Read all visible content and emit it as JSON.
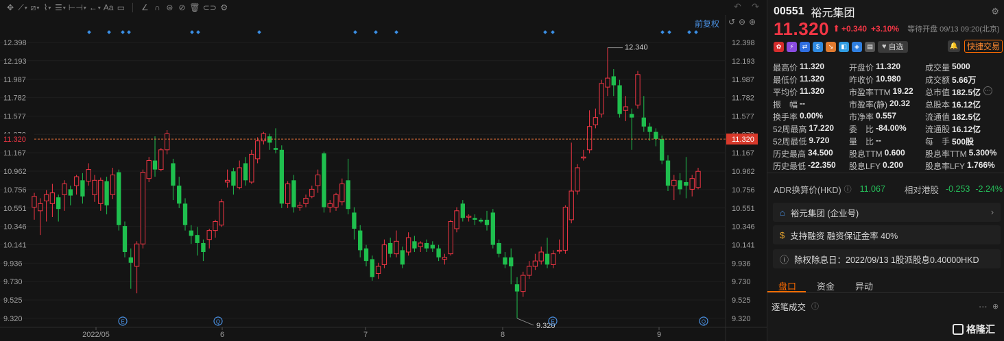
{
  "toolbar": {
    "icons": [
      "crosshair-icon",
      "line-tool-icon",
      "channel-tool-icon",
      "wave-tool-icon",
      "fib-tool-icon",
      "measure-tool-icon",
      "arrow-tool-icon",
      "text-tool-icon",
      "comment-tool-icon",
      "ruler-icon",
      "magnet-icon",
      "lock-draw-icon",
      "hide-draw-icon",
      "delete-icon",
      "toggle-icon",
      "settings-icon"
    ],
    "text_label": "Aa"
  },
  "chart": {
    "adjust_label": "前复权",
    "current_price_label": "11.320",
    "high_marker": "12.340",
    "low_marker": "9.320",
    "event_e": "E",
    "event_q": "Q"
  },
  "chart_data": {
    "type": "candlestick",
    "ylim": [
      9.22,
      12.52
    ],
    "yticks": [
      "12.398",
      "12.193",
      "11.987",
      "11.782",
      "11.577",
      "11.372",
      "11.167",
      "10.962",
      "10.756",
      "10.551",
      "10.346",
      "10.141",
      "9.936",
      "9.730",
      "9.525",
      "9.320"
    ],
    "xticks": [
      "2022/05",
      "6",
      "7",
      "8",
      "9"
    ],
    "current_price": 11.32,
    "candles": [
      [
        10.56,
        10.68,
        10.42,
        10.72
      ],
      [
        10.52,
        10.6,
        10.25,
        10.66
      ],
      [
        10.63,
        10.7,
        10.4,
        10.75
      ],
      [
        10.6,
        10.72,
        10.45,
        10.82
      ],
      [
        10.67,
        10.54,
        10.4,
        10.7
      ],
      [
        10.7,
        10.82,
        10.52,
        10.86
      ],
      [
        10.76,
        10.69,
        10.58,
        10.8
      ],
      [
        10.8,
        10.9,
        10.7,
        10.92
      ],
      [
        10.86,
        10.68,
        10.6,
        10.94
      ],
      [
        10.85,
        10.98,
        10.8,
        11.05
      ],
      [
        10.7,
        10.86,
        10.62,
        10.92
      ],
      [
        10.6,
        10.86,
        10.52,
        10.89
      ],
      [
        10.85,
        10.58,
        10.48,
        10.9
      ],
      [
        10.7,
        10.92,
        10.65,
        11.0
      ],
      [
        10.95,
        10.36,
        10.3,
        10.98
      ],
      [
        10.35,
        10.06,
        10.0,
        10.4
      ],
      [
        10.0,
        9.94,
        9.65,
        10.1
      ],
      [
        9.9,
        10.15,
        9.6,
        10.18
      ],
      [
        10.15,
        10.95,
        10.1,
        10.98
      ],
      [
        10.88,
        11.08,
        10.84,
        11.12
      ],
      [
        11.08,
        10.98,
        10.9,
        11.35
      ],
      [
        10.98,
        11.2,
        10.96,
        11.22
      ],
      [
        11.2,
        11.38,
        11.15,
        11.42
      ],
      [
        11.05,
        10.8,
        10.64,
        11.1
      ],
      [
        10.8,
        10.6,
        10.55,
        10.9
      ],
      [
        10.6,
        10.36,
        10.3,
        10.66
      ],
      [
        10.3,
        10.24,
        10.15,
        10.36
      ],
      [
        10.25,
        10.16,
        10.02,
        10.34
      ],
      [
        10.16,
        10.06,
        9.96,
        10.2
      ],
      [
        10.2,
        10.3,
        10.1,
        10.32
      ],
      [
        10.3,
        10.4,
        10.22,
        10.42
      ],
      [
        10.36,
        10.62,
        10.34,
        10.65
      ],
      [
        10.84,
        10.86,
        10.78,
        10.98
      ],
      [
        10.96,
        10.8,
        10.7,
        11.0
      ],
      [
        10.78,
        11.0,
        10.76,
        11.08
      ],
      [
        11.05,
        10.86,
        10.8,
        11.12
      ],
      [
        10.84,
        11.15,
        10.82,
        11.2
      ],
      [
        11.1,
        11.3,
        11.05,
        11.34
      ],
      [
        11.3,
        11.38,
        11.26,
        11.4
      ],
      [
        11.35,
        11.28,
        11.2,
        11.38
      ],
      [
        11.22,
        11.2,
        11.16,
        11.44
      ],
      [
        11.2,
        10.6,
        10.55,
        11.25
      ],
      [
        10.6,
        10.82,
        10.55,
        10.85
      ],
      [
        10.86,
        10.56,
        10.5,
        10.92
      ],
      [
        10.56,
        10.58,
        10.52,
        10.62
      ],
      [
        10.6,
        10.66,
        10.56,
        10.7
      ],
      [
        10.68,
        10.76,
        10.66,
        10.8
      ],
      [
        10.8,
        10.92,
        10.72,
        10.98
      ],
      [
        11.16,
        10.56,
        10.5,
        11.18
      ],
      [
        10.56,
        10.6,
        10.5,
        10.64
      ],
      [
        10.56,
        10.7,
        10.52,
        10.72
      ],
      [
        10.62,
        10.82,
        10.58,
        10.88
      ],
      [
        10.86,
        10.54,
        10.48,
        11.1
      ],
      [
        10.5,
        10.32,
        10.2,
        10.56
      ],
      [
        10.3,
        10.08,
        10.0,
        10.36
      ],
      [
        10.1,
        9.96,
        9.9,
        10.14
      ],
      [
        9.98,
        9.78,
        9.74,
        10.02
      ],
      [
        9.82,
        9.9,
        9.76,
        9.94
      ],
      [
        9.92,
        10.14,
        9.88,
        10.2
      ],
      [
        10.16,
        10.04,
        10.0,
        10.22
      ],
      [
        10.04,
        10.18,
        10.0,
        10.3
      ],
      [
        10.08,
        9.92,
        9.88,
        10.12
      ],
      [
        10.06,
        10.22,
        10.02,
        10.28
      ],
      [
        10.18,
        10.1,
        10.06,
        10.24
      ],
      [
        10.12,
        10.16,
        10.06,
        10.18
      ],
      [
        10.16,
        10.1,
        10.06,
        10.2
      ],
      [
        10.14,
        10.1,
        10.06,
        10.18
      ],
      [
        10.1,
        10.0,
        9.96,
        10.14
      ],
      [
        9.98,
        10.0,
        9.92,
        10.04
      ],
      [
        10.04,
        10.4,
        10.02,
        10.42
      ],
      [
        10.32,
        10.52,
        10.28,
        10.56
      ],
      [
        10.6,
        10.44,
        10.4,
        10.64
      ],
      [
        10.46,
        10.46,
        10.4,
        10.48
      ],
      [
        10.44,
        10.42,
        10.36,
        10.48
      ],
      [
        10.42,
        10.4,
        10.38,
        10.44
      ],
      [
        10.42,
        10.36,
        10.3,
        10.52
      ],
      [
        10.5,
        10.14,
        10.1,
        10.54
      ],
      [
        10.16,
        10.04,
        10.0,
        10.2
      ],
      [
        10.0,
        9.92,
        9.88,
        10.06
      ],
      [
        10.0,
        9.9,
        9.7,
        10.1
      ],
      [
        9.7,
        9.62,
        9.32,
        9.78
      ],
      [
        9.62,
        9.8,
        9.56,
        9.84
      ],
      [
        9.8,
        9.9,
        9.76,
        9.96
      ],
      [
        9.9,
        9.96,
        9.86,
        10.04
      ],
      [
        9.96,
        10.06,
        9.92,
        10.12
      ],
      [
        10.04,
        9.92,
        9.88,
        10.22
      ],
      [
        9.92,
        10.04,
        9.88,
        10.08
      ],
      [
        10.08,
        10.08,
        10.04,
        10.2
      ],
      [
        10.08,
        10.56,
        10.04,
        10.58
      ],
      [
        10.42,
        10.74,
        10.38,
        11.28
      ],
      [
        10.74,
        11.0,
        10.7,
        11.04
      ],
      [
        11.12,
        11.12,
        11.08,
        11.2
      ],
      [
        11.2,
        11.46,
        11.16,
        11.64
      ],
      [
        11.48,
        11.56,
        11.44,
        11.66
      ],
      [
        11.6,
        11.94,
        11.56,
        11.98
      ],
      [
        11.9,
        12.0,
        11.8,
        12.34
      ],
      [
        12.02,
        11.92,
        11.8,
        12.1
      ],
      [
        11.92,
        11.6,
        11.56,
        11.98
      ],
      [
        11.64,
        11.68,
        11.52,
        11.8
      ],
      [
        11.6,
        11.56,
        11.2,
        11.66
      ],
      [
        11.7,
        12.04,
        11.66,
        12.08
      ],
      [
        11.56,
        11.46,
        11.4,
        11.8
      ],
      [
        11.46,
        11.4,
        11.3,
        11.5
      ],
      [
        11.4,
        11.32,
        11.24,
        11.44
      ],
      [
        11.32,
        11.08,
        11.04,
        11.36
      ],
      [
        11.08,
        10.8,
        10.74,
        11.14
      ],
      [
        10.8,
        10.86,
        10.64,
        10.92
      ],
      [
        10.86,
        10.76,
        10.7,
        10.94
      ],
      [
        10.84,
        10.8,
        10.66,
        11.12
      ],
      [
        10.76,
        10.88,
        10.68,
        10.92
      ],
      [
        10.78,
        10.96,
        10.76,
        11.0
      ]
    ]
  },
  "quote": {
    "code": "00551",
    "name": "裕元集团",
    "price": "11.320",
    "arrow": "⬆",
    "change": "+0.340",
    "change_pct": "+3.10%",
    "status": "等待开盘 09/13 09:20(北京)",
    "watch_label": "自选",
    "quick_trade_label": "快捷交易"
  },
  "stats": [
    [
      {
        "k": "最高价",
        "v": "11.320",
        "c": "red"
      },
      {
        "k": "开盘价",
        "v": "11.320",
        "c": "red"
      },
      {
        "k": "成交量",
        "v": "5000",
        "c": ""
      }
    ],
    [
      {
        "k": "最低价",
        "v": "11.320",
        "c": "red"
      },
      {
        "k": "昨收价",
        "v": "10.980",
        "c": "plain"
      },
      {
        "k": "成交额",
        "v": "5.66万",
        "c": ""
      }
    ],
    [
      {
        "k": "平均价",
        "v": "11.320",
        "c": "red"
      },
      {
        "k": "市盈率TTM",
        "v": "19.22",
        "c": ""
      },
      {
        "k": "总市值",
        "v": "182.5亿",
        "c": ""
      }
    ],
    [
      {
        "k": "振　幅",
        "v": "--",
        "c": ""
      },
      {
        "k": "市盈率(静)",
        "v": "20.32",
        "c": ""
      },
      {
        "k": "总股本",
        "v": "16.12亿",
        "c": ""
      }
    ],
    [
      {
        "k": "换手率",
        "v": "0.00%",
        "c": ""
      },
      {
        "k": "市净率",
        "v": "0.557",
        "c": ""
      },
      {
        "k": "流通值",
        "v": "182.5亿",
        "c": ""
      }
    ],
    [
      {
        "k": "52周最高",
        "v": "17.220",
        "c": "red"
      },
      {
        "k": "委　比",
        "v": "-84.00%",
        "c": ""
      },
      {
        "k": "流通股",
        "v": "16.12亿",
        "c": ""
      }
    ],
    [
      {
        "k": "52周最低",
        "v": "9.720",
        "c": "green"
      },
      {
        "k": "量　比",
        "v": "--",
        "c": ""
      },
      {
        "k": "每　手",
        "v": "500股",
        "c": ""
      }
    ],
    [
      {
        "k": "历史最高",
        "v": "34.500",
        "c": "red"
      },
      {
        "k": "股息TTM",
        "v": "0.600",
        "c": ""
      },
      {
        "k": "股息率TTM",
        "v": "5.300%",
        "c": ""
      }
    ],
    [
      {
        "k": "历史最低",
        "v": "-22.350",
        "c": "green"
      },
      {
        "k": "股息LFY",
        "v": "0.200",
        "c": ""
      },
      {
        "k": "股息率LFY",
        "v": "1.766%",
        "c": ""
      }
    ]
  ],
  "adr": {
    "label": "ADR换算价(HKD)",
    "value": "11.067",
    "rel_label": "相对港股",
    "rel_change": "-0.253",
    "rel_pct": "-2.24%"
  },
  "cards": {
    "company": "裕元集团 (企业号)",
    "margin": "支持融资 融资保证金率 40%",
    "dividend": "除权除息日：2022/09/13  1股派股息0.40000HKD"
  },
  "tabs": [
    "盘口",
    "资金",
    "异动"
  ],
  "ticks": {
    "label": "逐笔成交"
  },
  "watermark": "格隆汇",
  "colors": {
    "up": "#f23645",
    "down": "#1fbf4e",
    "accent": "#ff6b00",
    "price_line": "#e0703a"
  }
}
